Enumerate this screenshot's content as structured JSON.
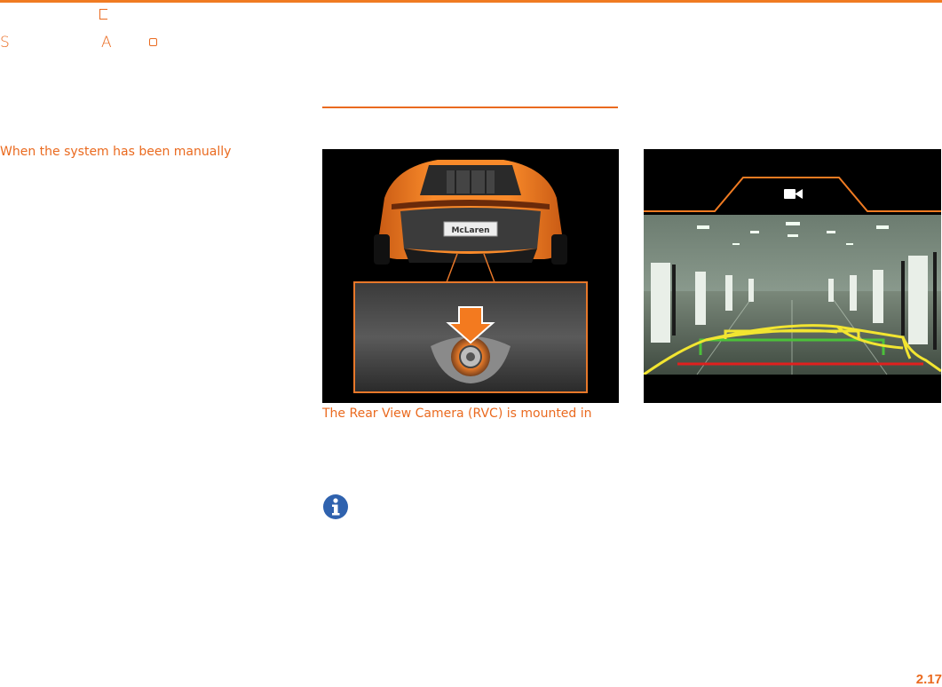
{
  "header": {
    "fragments": [
      "S",
      "A"
    ]
  },
  "left_column": {
    "text": "When the system has been manually"
  },
  "figures": {
    "car_rear": {
      "plate_text": "McLaren"
    },
    "rvc_display": {
      "icon": "video-camera-icon"
    }
  },
  "caption": "The Rear View Camera (RVC) is mounted in",
  "note": {
    "icon": "info-icon"
  },
  "footer": {
    "page_number": "2.17"
  },
  "colors": {
    "accent": "#ea6a1f",
    "car_orange": "#f37a1f",
    "guide_yellow": "#f2e531",
    "guide_green": "#4cc13a",
    "guide_red": "#e0201e",
    "info_blue": "#2f62ae"
  }
}
